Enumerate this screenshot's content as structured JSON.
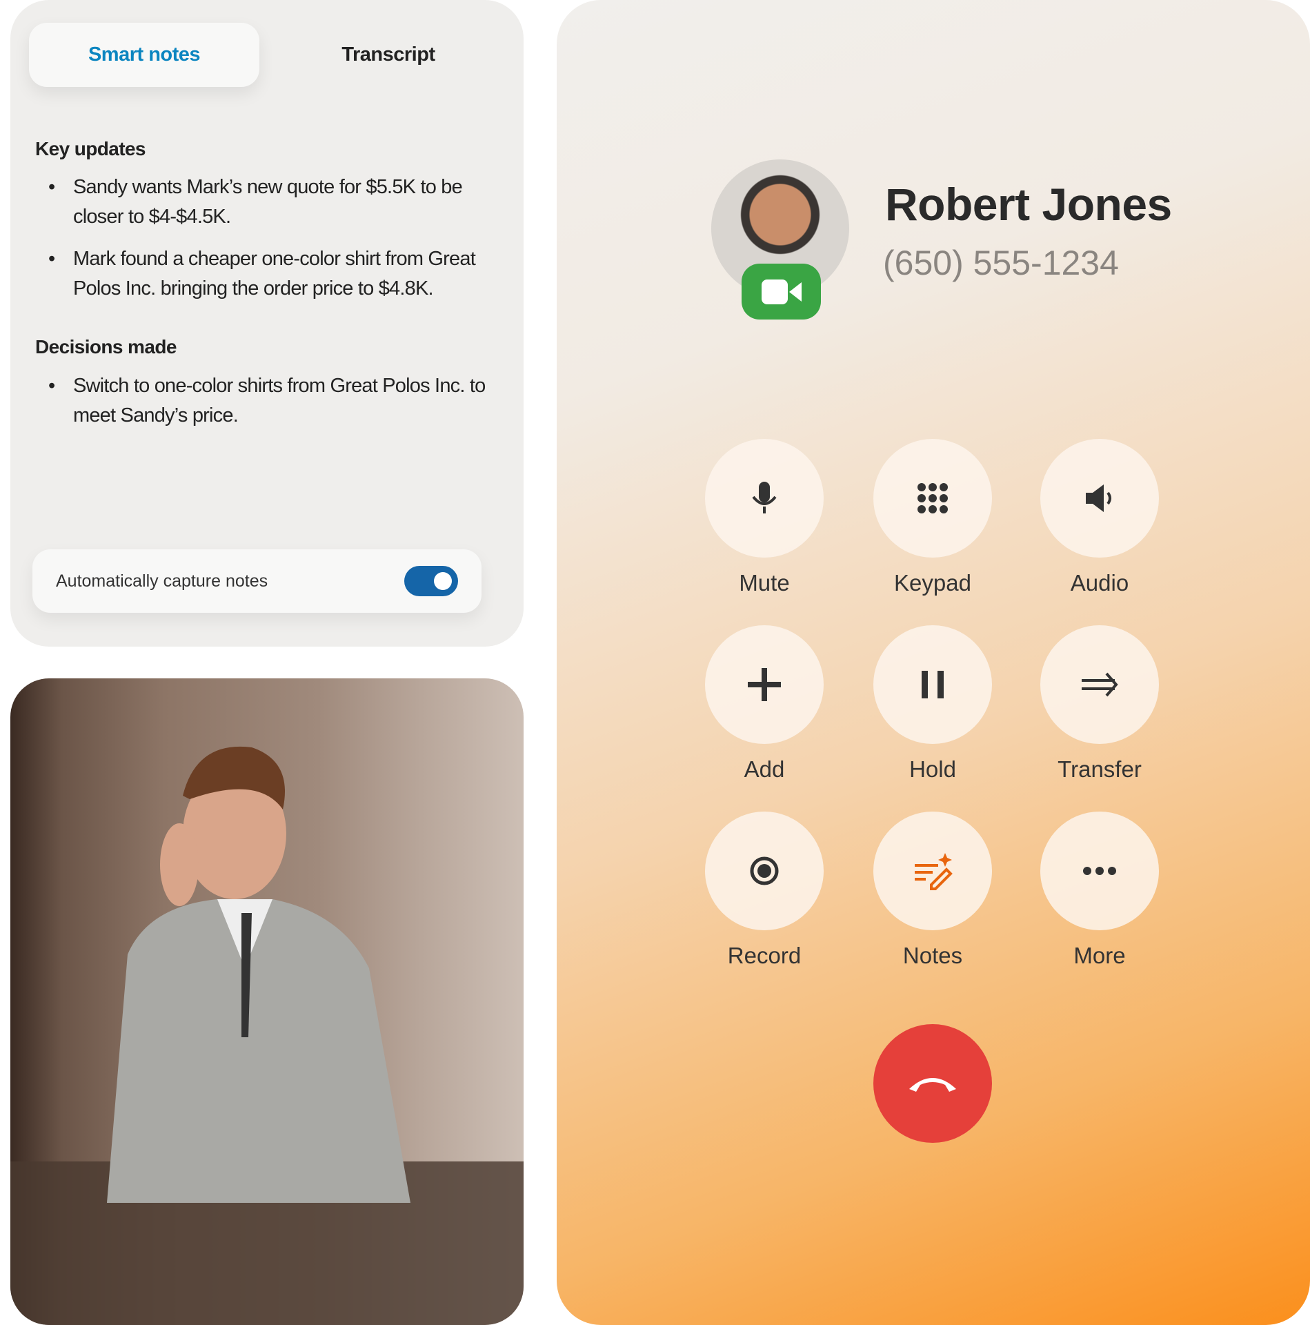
{
  "notes": {
    "tabs": [
      {
        "label": "Smart notes",
        "active": true
      },
      {
        "label": "Transcript",
        "active": false
      }
    ],
    "sections": [
      {
        "title": "Key updates",
        "items": [
          "Sandy wants Mark’s new quote for $5.5K to be closer to $4-$4.5K.",
          "Mark found a cheaper one-color shirt from Great Polos Inc. bringing the order price to $4.8K."
        ]
      },
      {
        "title": "Decisions made",
        "items": [
          "Switch to one-color shirts from Great Polos Inc. to meet Sandy’s price."
        ]
      }
    ],
    "auto_capture": {
      "label": "Automatically capture notes",
      "enabled": true
    },
    "accent": "#0b85c0"
  },
  "call": {
    "name": "Robert Jones",
    "phone": "(650) 555-1234",
    "video_icon": "video-camera-icon",
    "buttons": [
      {
        "label": "Mute",
        "icon": "microphone-icon"
      },
      {
        "label": "Keypad",
        "icon": "keypad-icon"
      },
      {
        "label": "Audio",
        "icon": "speaker-icon"
      },
      {
        "label": "Add",
        "icon": "plus-icon"
      },
      {
        "label": "Hold",
        "icon": "pause-icon"
      },
      {
        "label": "Transfer",
        "icon": "arrow-right-icon"
      },
      {
        "label": "Record",
        "icon": "record-icon"
      },
      {
        "label": "Notes",
        "icon": "ai-notes-icon"
      },
      {
        "label": "More",
        "icon": "more-dots-icon"
      }
    ],
    "end_call_icon": "hang-up-icon",
    "colors": {
      "end": "#e5403a",
      "video": "#3aa544",
      "notes_icon": "#e8650e"
    }
  }
}
